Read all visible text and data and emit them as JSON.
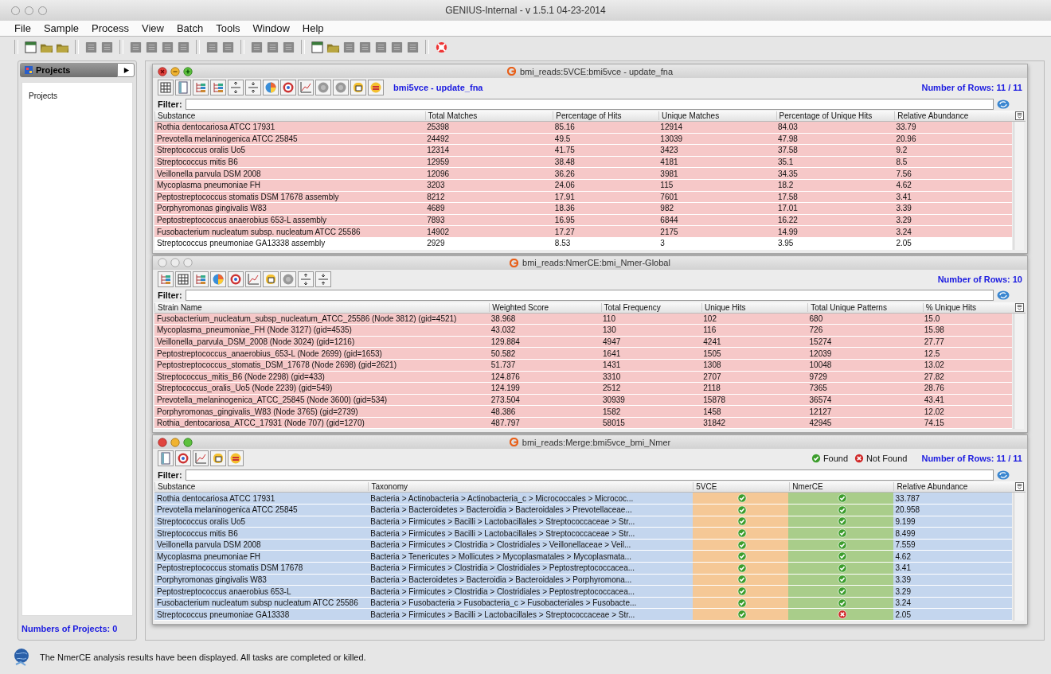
{
  "window": {
    "title": "GENIUS-Internal - v 1.5.1 04-23-2014"
  },
  "menu": [
    "File",
    "Sample",
    "Process",
    "View",
    "Batch",
    "Tools",
    "Window",
    "Help"
  ],
  "sidebar": {
    "tab": "Projects",
    "tree_root": "Projects",
    "footer": "Numbers of Projects: 0"
  },
  "frames": [
    {
      "title": "bmi_reads:5VCE:bmi5vce - update_fna",
      "active": true,
      "subtitle": "bmi5vce - update_fna",
      "row_count": "Number of Rows: 11 / 11",
      "filter_label": "Filter:",
      "columns": [
        {
          "label": "Substance",
          "kind": "text"
        },
        {
          "label": "Total Matches",
          "kind": "text"
        },
        {
          "label": "Percentage of Hits",
          "kind": "text"
        },
        {
          "label": "Unique Matches",
          "kind": "text"
        },
        {
          "label": "Percentage of Unique Hits",
          "kind": "text"
        },
        {
          "label": "Relative Abundance",
          "kind": "text"
        }
      ],
      "rows": [
        {
          "highlighted": true,
          "cells": [
            "Rothia dentocariosa ATCC 17931",
            "25398",
            "85.16",
            "12914",
            "84.03",
            "33.79"
          ]
        },
        {
          "highlighted": true,
          "cells": [
            "Prevotella melaninogenica ATCC 25845",
            "24492",
            "49.5",
            "13039",
            "47.98",
            "20.96"
          ]
        },
        {
          "highlighted": true,
          "cells": [
            "Streptococcus oralis Uo5",
            "12314",
            "41.75",
            "3423",
            "37.58",
            "9.2"
          ]
        },
        {
          "highlighted": true,
          "cells": [
            "Streptococcus mitis B6",
            "12959",
            "38.48",
            "4181",
            "35.1",
            "8.5"
          ]
        },
        {
          "highlighted": true,
          "cells": [
            "Veillonella parvula DSM 2008",
            "12096",
            "36.26",
            "3981",
            "34.35",
            "7.56"
          ]
        },
        {
          "highlighted": true,
          "cells": [
            "Mycoplasma pneumoniae FH",
            "3203",
            "24.06",
            "115",
            "18.2",
            "4.62"
          ]
        },
        {
          "highlighted": true,
          "cells": [
            "Peptostreptococcus stomatis DSM 17678 assembly",
            "8212",
            "17.91",
            "7601",
            "17.58",
            "3.41"
          ]
        },
        {
          "highlighted": true,
          "cells": [
            "Porphyromonas gingivalis W83",
            "4689",
            "18.36",
            "982",
            "17.01",
            "3.39"
          ]
        },
        {
          "highlighted": true,
          "cells": [
            "Peptostreptococcus anaerobius 653-L assembly",
            "7893",
            "16.95",
            "6844",
            "16.22",
            "3.29"
          ]
        },
        {
          "highlighted": true,
          "cells": [
            "Fusobacterium nucleatum subsp. nucleatum ATCC 25586",
            "14902",
            "17.27",
            "2175",
            "14.99",
            "3.24"
          ]
        },
        {
          "highlighted": false,
          "cells": [
            "Streptococcus pneumoniae GA13338 assembly",
            "2929",
            "8.53",
            "3",
            "3.95",
            "2.05"
          ]
        }
      ]
    },
    {
      "title": "bmi_reads:NmerCE:bmi_Nmer-Global",
      "active": false,
      "row_count": "Number of Rows: 10",
      "filter_label": "Filter:",
      "columns": [
        {
          "label": "Strain Name",
          "kind": "text"
        },
        {
          "label": "Weighted Score",
          "kind": "text"
        },
        {
          "label": "Total Frequency",
          "kind": "text"
        },
        {
          "label": "Unique Hits",
          "kind": "text"
        },
        {
          "label": "Total Unique Patterns",
          "kind": "text"
        },
        {
          "label": "% Unique Hits",
          "kind": "text"
        }
      ],
      "rows": [
        {
          "highlighted": true,
          "cells": [
            "Fusobacterium_nucleatum_subsp_nucleatum_ATCC_25586 (Node 3812) (gid=4521)",
            "38.968",
            "110",
            "102",
            "680",
            "15.0"
          ]
        },
        {
          "highlighted": true,
          "cells": [
            "Mycoplasma_pneumoniae_FH (Node 3127) (gid=4535)",
            "43.032",
            "130",
            "116",
            "726",
            "15.98"
          ]
        },
        {
          "highlighted": true,
          "cells": [
            "Veillonella_parvula_DSM_2008 (Node 3024) (gid=1216)",
            "129.884",
            "4947",
            "4241",
            "15274",
            "27.77"
          ]
        },
        {
          "highlighted": true,
          "cells": [
            "Peptostreptococcus_anaerobius_653-L (Node 2699) (gid=1653)",
            "50.582",
            "1641",
            "1505",
            "12039",
            "12.5"
          ]
        },
        {
          "highlighted": true,
          "cells": [
            "Peptostreptococcus_stomatis_DSM_17678 (Node 2698) (gid=2621)",
            "51.737",
            "1431",
            "1308",
            "10048",
            "13.02"
          ]
        },
        {
          "highlighted": true,
          "cells": [
            "Streptococcus_mitis_B6 (Node 2298) (gid=433)",
            "124.876",
            "3310",
            "2707",
            "9729",
            "27.82"
          ]
        },
        {
          "highlighted": true,
          "cells": [
            "Streptococcus_oralis_Uo5 (Node 2239) (gid=549)",
            "124.199",
            "2512",
            "2118",
            "7365",
            "28.76"
          ]
        },
        {
          "highlighted": true,
          "cells": [
            "Prevotella_melaninogenica_ATCC_25845 (Node 3600) (gid=534)",
            "273.504",
            "30939",
            "15878",
            "36574",
            "43.41"
          ]
        },
        {
          "highlighted": true,
          "cells": [
            "Porphyromonas_gingivalis_W83 (Node 3765) (gid=2739)",
            "48.386",
            "1582",
            "1458",
            "12127",
            "12.02"
          ]
        },
        {
          "highlighted": true,
          "cells": [
            "Rothia_dentocariosa_ATCC_17931 (Node 707) (gid=1270)",
            "487.797",
            "58015",
            "31842",
            "42945",
            "74.15"
          ]
        }
      ]
    },
    {
      "title": "bmi_reads:Merge:bmi5vce_bmi_Nmer",
      "active": true,
      "row_count": "Number of Rows: 11 / 11",
      "filter_label": "Filter:",
      "legend": [
        {
          "label": "Found",
          "found": true
        },
        {
          "label": "Not Found",
          "found": false
        }
      ],
      "columns": [
        {
          "label": "Substance",
          "kind": "text"
        },
        {
          "label": "Taxonomy",
          "kind": "text"
        },
        {
          "label": "5VCE",
          "kind": "status",
          "color": "#f5c896"
        },
        {
          "label": "NmerCE",
          "kind": "status",
          "color": "#a9cd8a"
        },
        {
          "label": "Relative Abundance",
          "kind": "text"
        }
      ],
      "rows": [
        {
          "highlighted": true,
          "cells": [
            "Rothia dentocariosa ATCC 17931",
            "Bacteria > Actinobacteria > Actinobacteria_c > Micrococcales > Micrococ...",
            true,
            true,
            "33.787"
          ]
        },
        {
          "highlighted": true,
          "cells": [
            "Prevotella melaninogenica ATCC 25845",
            "Bacteria > Bacteroidetes > Bacteroidia > Bacteroidales > Prevotellaceae...",
            true,
            true,
            "20.958"
          ]
        },
        {
          "highlighted": true,
          "cells": [
            "Streptococcus oralis Uo5",
            "Bacteria > Firmicutes > Bacilli > Lactobacillales > Streptococcaceae > Str...",
            true,
            true,
            "9.199"
          ]
        },
        {
          "highlighted": true,
          "cells": [
            "Streptococcus mitis B6",
            "Bacteria > Firmicutes > Bacilli > Lactobacillales > Streptococcaceae > Str...",
            true,
            true,
            "8.499"
          ]
        },
        {
          "highlighted": true,
          "cells": [
            "Veillonella parvula DSM 2008",
            "Bacteria > Firmicutes > Clostridia > Clostridiales > Veillonellaceae > Veil...",
            true,
            true,
            "7.559"
          ]
        },
        {
          "highlighted": true,
          "cells": [
            "Mycoplasma pneumoniae FH",
            "Bacteria > Tenericutes > Mollicutes > Mycoplasmatales > Mycoplasmata...",
            true,
            true,
            "4.62"
          ]
        },
        {
          "highlighted": true,
          "cells": [
            "Peptostreptococcus stomatis DSM 17678",
            "Bacteria > Firmicutes > Clostridia > Clostridiales > Peptostreptococcacea...",
            true,
            true,
            "3.41"
          ]
        },
        {
          "highlighted": true,
          "cells": [
            "Porphyromonas gingivalis W83",
            "Bacteria > Bacteroidetes > Bacteroidia > Bacteroidales > Porphyromona...",
            true,
            true,
            "3.39"
          ]
        },
        {
          "highlighted": true,
          "cells": [
            "Peptostreptococcus anaerobius 653-L",
            "Bacteria > Firmicutes > Clostridia > Clostridiales > Peptostreptococcacea...",
            true,
            true,
            "3.29"
          ]
        },
        {
          "highlighted": true,
          "cells": [
            "Fusobacterium nucleatum subsp nucleatum ATCC 25586",
            "Bacteria > Fusobacteria > Fusobacteria_c > Fusobacteriales > Fusobacte...",
            true,
            true,
            "3.24"
          ]
        },
        {
          "highlighted": true,
          "cells": [
            "Streptococcus pneumoniae GA13338",
            "Bacteria > Firmicutes > Bacilli > Lactobacillales > Streptococcaceae > Str...",
            true,
            false,
            "2.05"
          ]
        }
      ]
    }
  ],
  "status_bar": {
    "message": "The NmerCE analysis results have been displayed. All tasks are completed or killed."
  }
}
